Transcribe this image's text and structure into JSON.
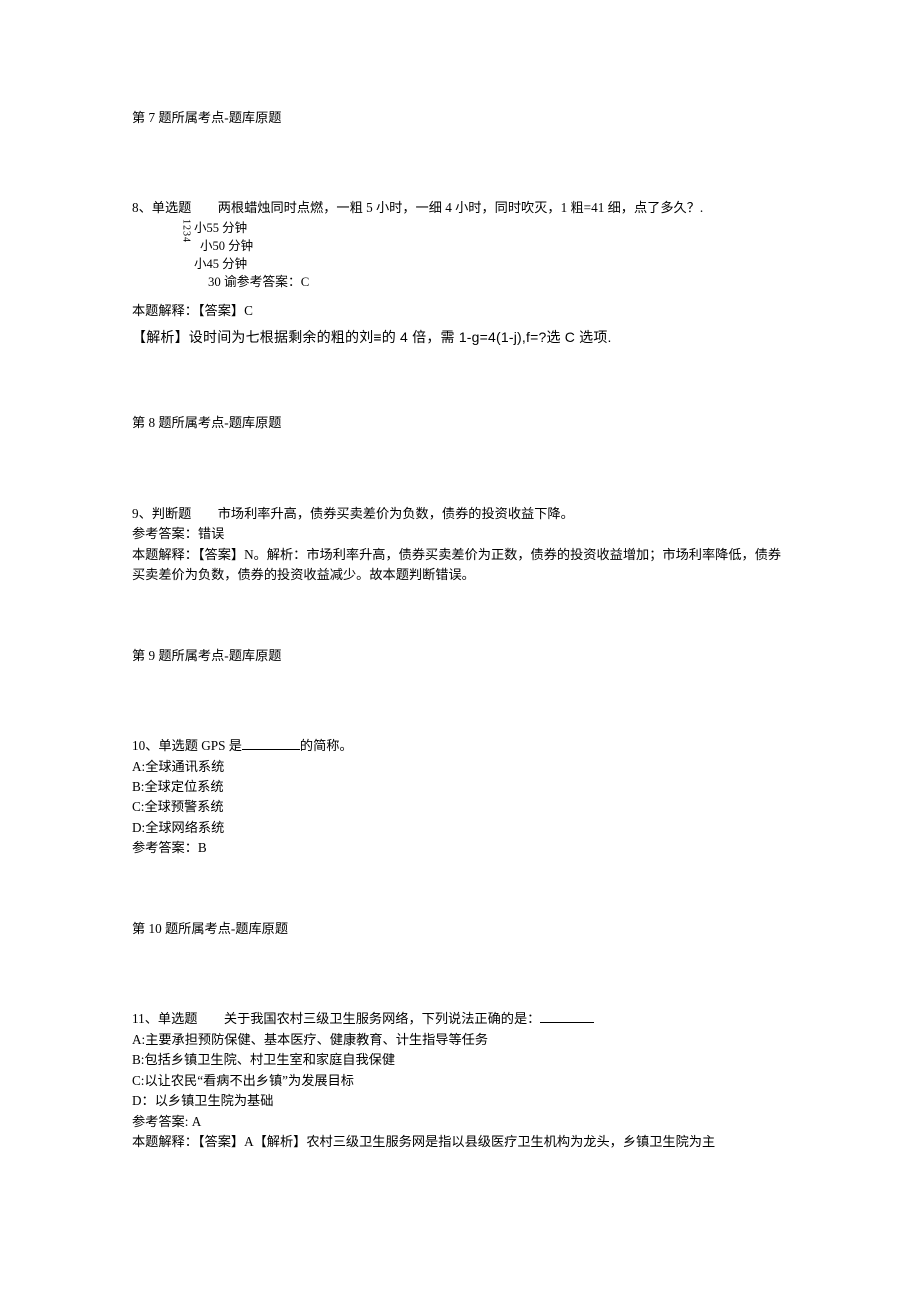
{
  "q7": {
    "topic": "第 7 题所属考点-题库原题"
  },
  "q8": {
    "stem": "8、单选题　　两根蜡烛同时点燃，一粗 5 小时，一细 4 小时，同时吹灭，1 粗=41 细，点了多久？.",
    "vertical": "1234",
    "opt1": "小55 分钟",
    "opt2": "小50 分钟",
    "opt3": "小45 分钟",
    "opt4": "30 谕参考答案：C",
    "ans": "本题解释：【答案】C",
    "explain": "【解析】设时间为七根据剩余的粗的刘≡的 4 倍，需 1-g=4(1-j),f=?选 C 选项.",
    "topic": "第 8 题所属考点-题库原题"
  },
  "q9": {
    "stem": "9、判断题　　市场利率升高，债券买卖差价为负数，债券的投资收益下降。",
    "ref": "参考答案：错误",
    "explain1": "本题解释：【答案】N。解析：市场利率升高，债券买卖差价为正数，债券的投资收益增加；市场利率降低，债券",
    "explain2": "买卖差价为负数，债券的投资收益减少。故本题判断错误。",
    "topic": "第 9 题所属考点-题库原题"
  },
  "q10": {
    "stem_a": "10、单选题 GPS 是",
    "stem_b": "的简称。",
    "optA": "A:全球通讯系统",
    "optB": "B:全球定位系统",
    "optC": "C:全球预警系统",
    "optD": "D:全球网络系统",
    "ref": "参考答案：B",
    "topic": "第 10 题所属考点-题库原题"
  },
  "q11": {
    "stem_a": "11、单选题　　关于我国农村三级卫生服务网络，下列说法正确的是：",
    "optA": "A:主要承担预防保健、基本医疗、健康教育、计生指导等任务",
    "optB": "B:包括乡镇卫生院、村卫生室和家庭自我保健",
    "optC": "C:以让农民“看病不出乡镇”为发展目标",
    "optD": "D：以乡镇卫生院为基础",
    "ref": "参考答案: A",
    "explain": "本题解释：【答案】A【解析】农村三级卫生服务网是指以县级医疗卫生机构为龙头，乡镇卫生院为主"
  }
}
